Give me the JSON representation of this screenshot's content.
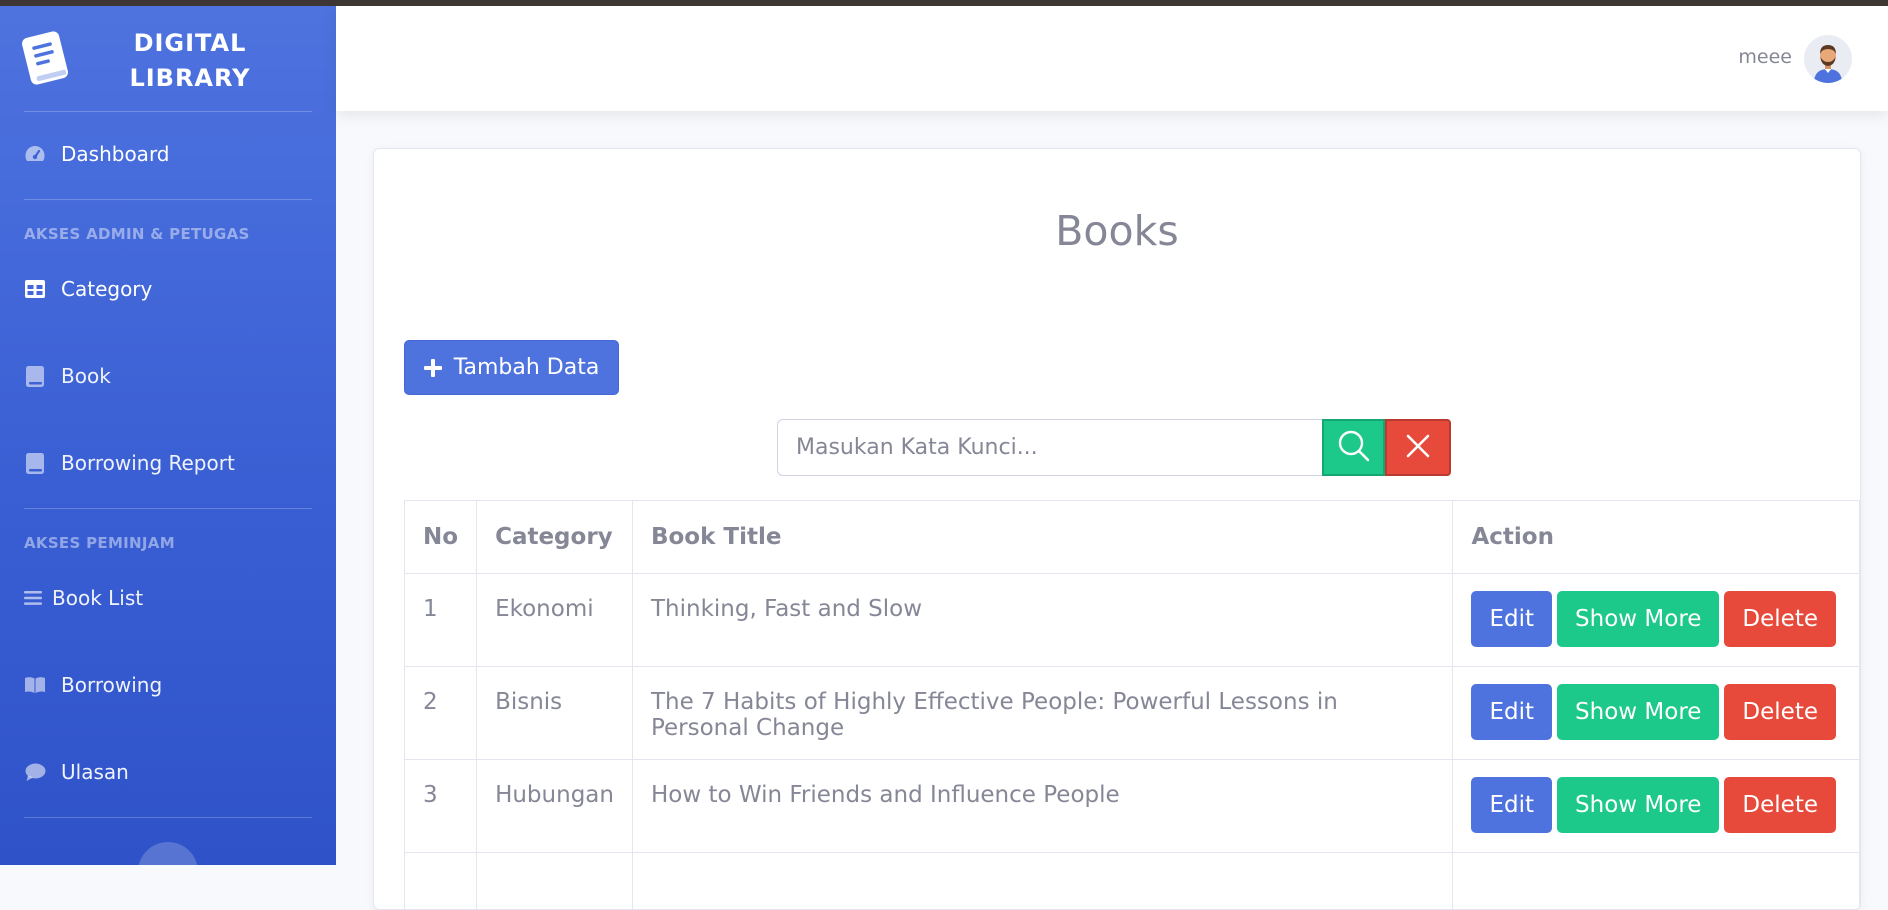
{
  "brand": {
    "line1": "DIGITAL",
    "line2": "LIBRARY",
    "icon": "book-icon"
  },
  "sidebar": {
    "dashboard": {
      "label": "Dashboard",
      "icon": "tachometer-icon"
    },
    "section_admin": "AKSES ADMIN & PETUGAS",
    "admin_items": [
      {
        "label": "Category",
        "icon": "table-icon"
      },
      {
        "label": "Book",
        "icon": "book-icon"
      },
      {
        "label": "Borrowing Report",
        "icon": "book-icon"
      }
    ],
    "section_borrower": "AKSES PEMINJAM",
    "borrower_items": [
      {
        "label": "Book List",
        "icon": "list-icon"
      },
      {
        "label": "Borrowing",
        "icon": "open-book-icon"
      },
      {
        "label": "Ulasan",
        "icon": "comment-icon"
      }
    ]
  },
  "topbar": {
    "username": "meee",
    "avatar": "avatar-icon"
  },
  "main": {
    "title": "Books",
    "add_button": "Tambah Data",
    "search": {
      "placeholder": "Masukan Kata Kunci...",
      "value": ""
    }
  },
  "table": {
    "headers": [
      "No",
      "Category",
      "Book Title",
      "Action"
    ],
    "rows": [
      {
        "no": "1",
        "category": "Ekonomi",
        "title": "Thinking, Fast and Slow"
      },
      {
        "no": "2",
        "category": "Bisnis",
        "title": "The 7 Habits of Highly Effective People: Powerful Lessons in Personal Change"
      },
      {
        "no": "3",
        "category": "Hubungan",
        "title": "How to Win Friends and Influence People"
      }
    ],
    "actions": {
      "edit": "Edit",
      "show_more": "Show More",
      "delete": "Delete"
    }
  },
  "colors": {
    "primary": "#4e73df",
    "success": "#1cc88a",
    "danger": "#e74a3b",
    "text": "#858796"
  }
}
